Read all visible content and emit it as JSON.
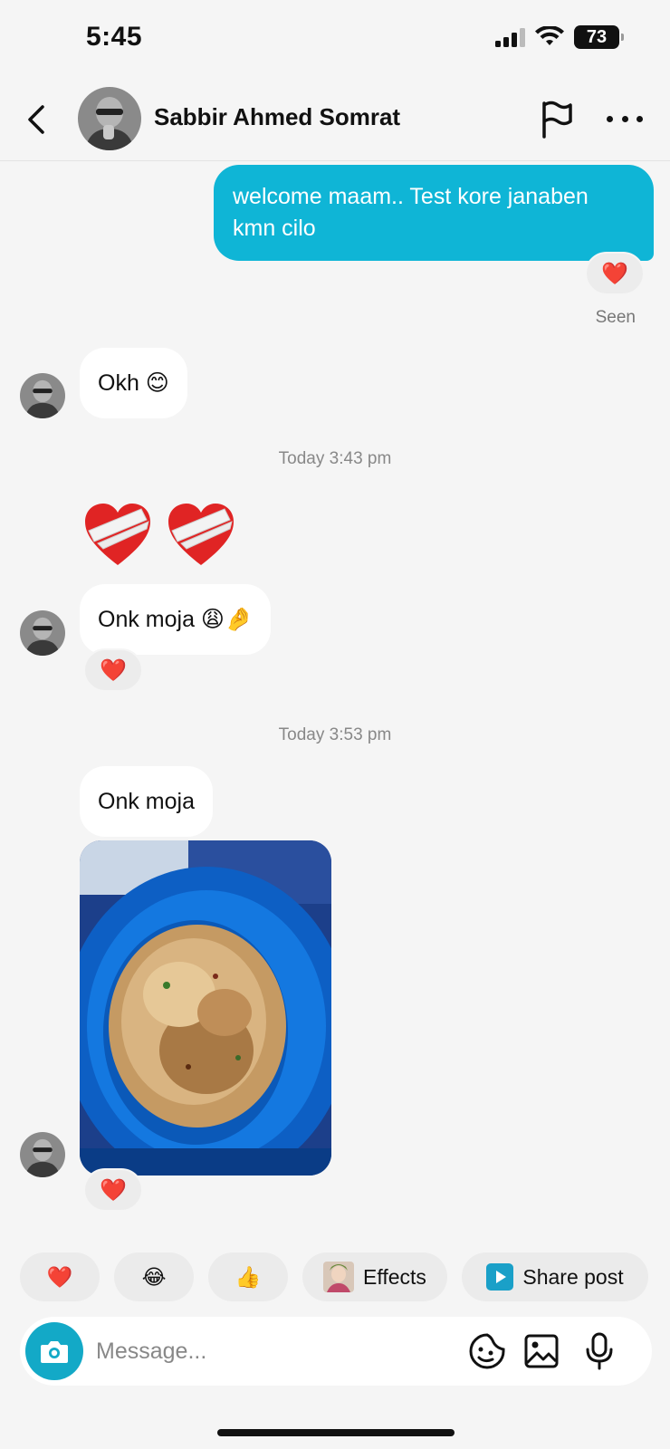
{
  "status_bar": {
    "time": "5:45",
    "battery": "73"
  },
  "header": {
    "contact_name": "Sabbir Ahmed Somrat",
    "back_icon": "chevron-left-icon",
    "flag_icon": "flag-icon",
    "more_icon": "more-horizontal-icon"
  },
  "messages": [
    {
      "direction": "outgoing",
      "text": "welcome maam.. Test kore janaben kmn cilo",
      "reaction": "❤️"
    },
    {
      "direction": "incoming",
      "text": "Okh 😊"
    },
    {
      "type": "timestamp",
      "text": "Today 3:43 pm"
    },
    {
      "direction": "incoming",
      "type": "emoji-large",
      "text": "❤️‍🩹❤️‍🩹"
    },
    {
      "direction": "incoming",
      "text": "Onk moja 😩🤌",
      "reaction": "❤️"
    },
    {
      "type": "timestamp",
      "text": "Today 3:53 pm"
    },
    {
      "direction": "incoming",
      "text": "Onk moja"
    },
    {
      "direction": "incoming",
      "type": "photo",
      "reaction": "❤️"
    }
  ],
  "seen_label": "Seen",
  "quick_reactions": {
    "heart": "❤️",
    "laugh": "😂",
    "thumbs": "👍",
    "effects_label": "Effects",
    "share_label": "Share post"
  },
  "composer": {
    "placeholder": "Message..."
  },
  "colors": {
    "outgoing_bubble": "#0fb5d6",
    "camera_button": "#13a9c7",
    "background": "#f5f5f5"
  }
}
